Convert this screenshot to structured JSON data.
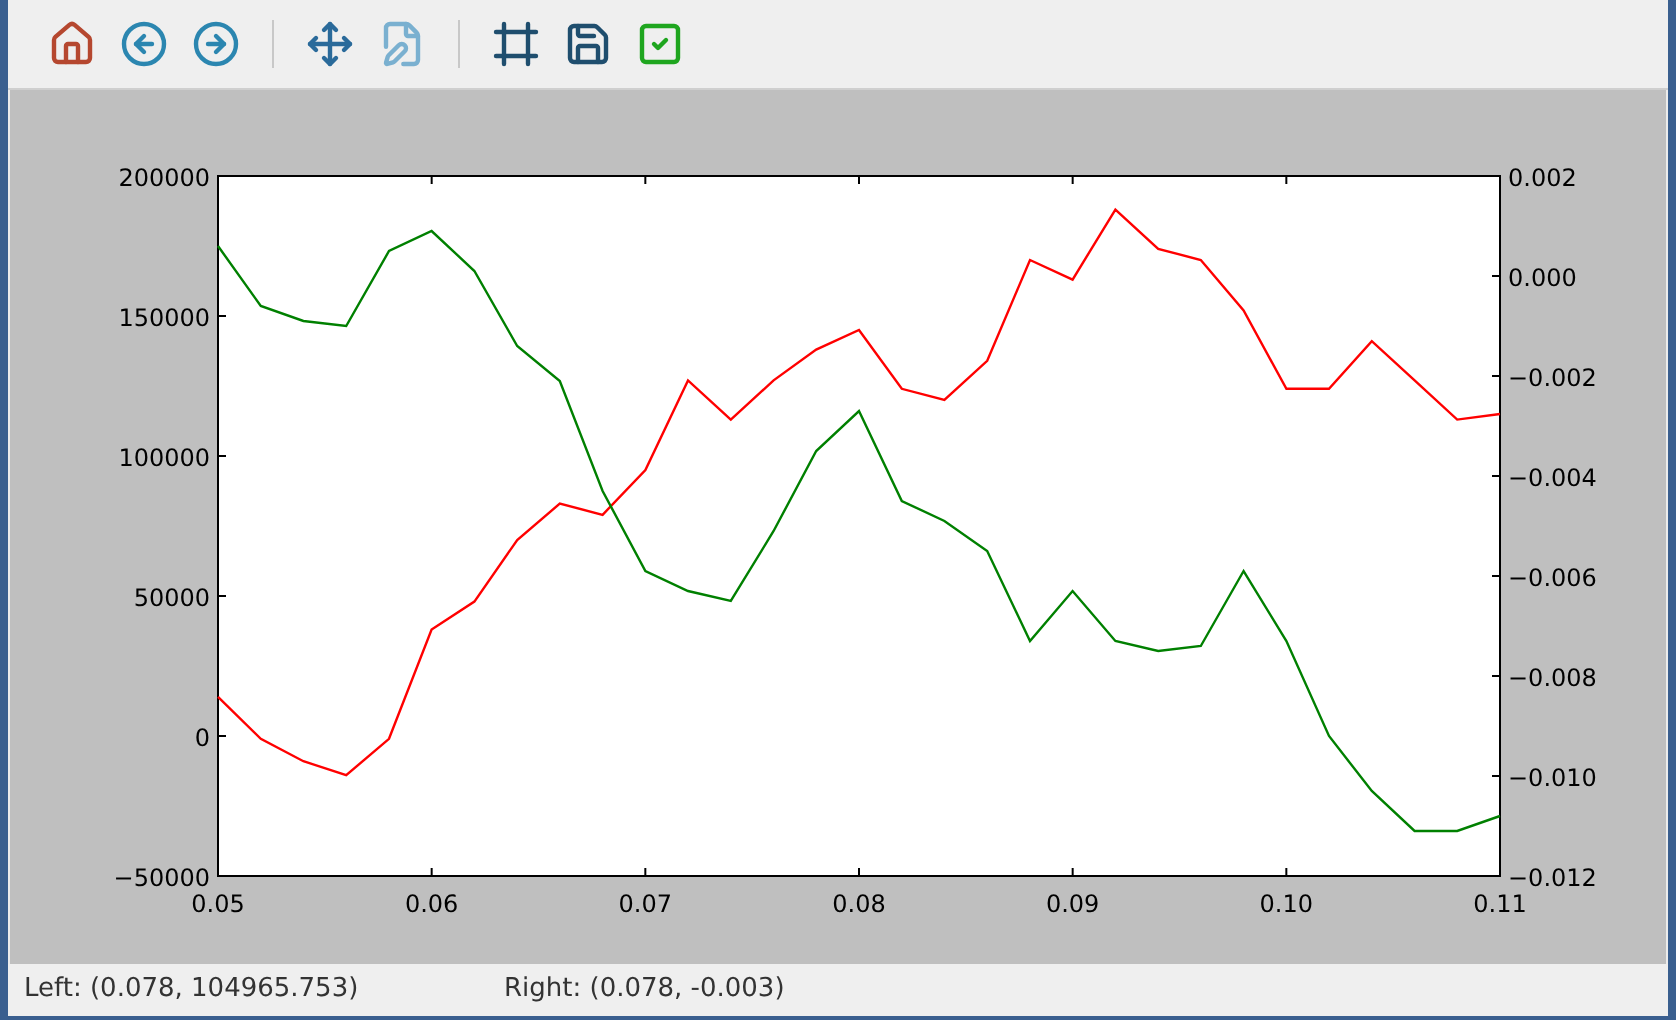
{
  "figure": {
    "chart_data": {
      "type": "line",
      "x": [
        0.05,
        0.052,
        0.054,
        0.056,
        0.058,
        0.06,
        0.062,
        0.064,
        0.066,
        0.068,
        0.07,
        0.072,
        0.074,
        0.076,
        0.078,
        0.08,
        0.082,
        0.084,
        0.086,
        0.088,
        0.09,
        0.092,
        0.094,
        0.096,
        0.098,
        0.1,
        0.102,
        0.104,
        0.106,
        0.108,
        0.11
      ],
      "series": [
        {
          "color": "#ff0000",
          "values": [
            14000,
            -1000,
            -9000,
            -14000,
            -1000,
            38000,
            48000,
            70000,
            83000,
            79000,
            95000,
            127000,
            113000,
            127000,
            138000,
            145000,
            124000,
            120000,
            134000,
            170000,
            163000,
            188000,
            174000,
            170000,
            152000,
            124000,
            124000,
            141000,
            127000,
            113000,
            115000
          ]
        },
        {
          "axis": "y2",
          "color": "#008000",
          "values": [
            0.0006,
            -0.0006,
            -0.0009,
            -0.001,
            0.0005,
            0.0009,
            0.0001,
            -0.0014,
            -0.0021,
            -0.0043,
            -0.0059,
            -0.0063,
            -0.0065,
            -0.0051,
            -0.0035,
            -0.0027,
            -0.0045,
            -0.0049,
            -0.0055,
            -0.0073,
            -0.0063,
            -0.0073,
            -0.0075,
            -0.0074,
            -0.0059,
            -0.0073,
            -0.0092,
            -0.0103,
            -0.0111,
            -0.0111,
            -0.0108
          ]
        }
      ],
      "xlim": [
        0.05,
        0.11
      ],
      "ylim": [
        -50000,
        200000
      ],
      "y2lim": [
        -0.012,
        0.002
      ],
      "xticks": [
        {
          "value": 0.05,
          "label": "0.05"
        },
        {
          "value": 0.06,
          "label": "0.06"
        },
        {
          "value": 0.07,
          "label": "0.07"
        },
        {
          "value": 0.08,
          "label": "0.08"
        },
        {
          "value": 0.09,
          "label": "0.09"
        },
        {
          "value": 0.1,
          "label": "0.10"
        },
        {
          "value": 0.11,
          "label": "0.11"
        }
      ],
      "yticks": [
        {
          "value": -50000,
          "label": "−50000"
        },
        {
          "value": 0,
          "label": "0"
        },
        {
          "value": 50000,
          "label": "50000"
        },
        {
          "value": 100000,
          "label": "100000"
        },
        {
          "value": 150000,
          "label": "150000"
        },
        {
          "value": 200000,
          "label": "200000"
        }
      ],
      "y2ticks": [
        {
          "value": -0.012,
          "label": "−0.012"
        },
        {
          "value": -0.01,
          "label": "−0.010"
        },
        {
          "value": -0.008,
          "label": "−0.008"
        },
        {
          "value": -0.006,
          "label": "−0.006"
        },
        {
          "value": -0.004,
          "label": "−0.004"
        },
        {
          "value": -0.002,
          "label": "−0.002"
        },
        {
          "value": 0,
          "label": "0.000"
        },
        {
          "value": 0.002,
          "label": "0.002"
        }
      ]
    }
  },
  "status_bar": {
    "left": "Left: (0.078, 104965.753)",
    "right": "Right: (0.078, -0.003)"
  }
}
